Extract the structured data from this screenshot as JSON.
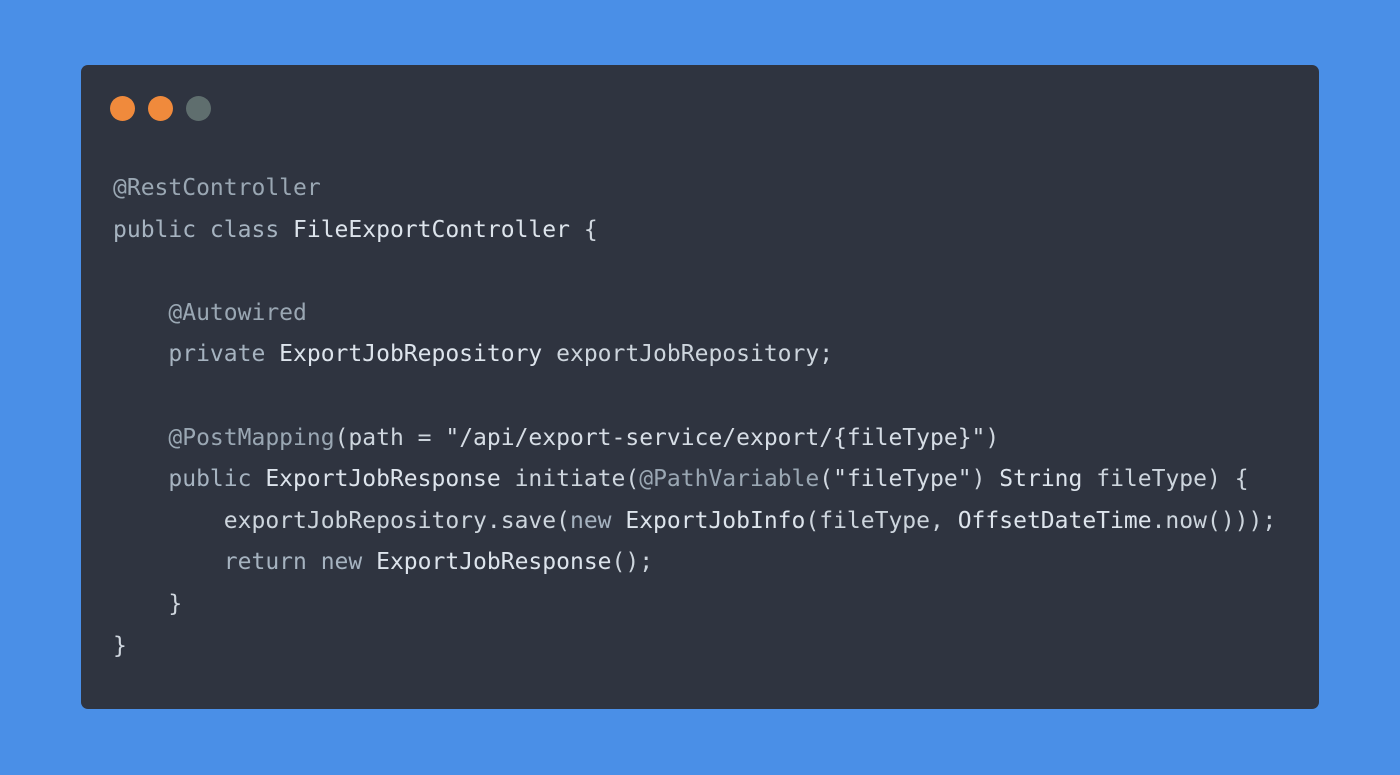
{
  "colors": {
    "background": "#4a8fe7",
    "window": "#2f3440",
    "dot_1": "#f08a3c",
    "dot_2": "#f08a3c",
    "dot_3": "#5f6e6e"
  },
  "code": {
    "language": "java",
    "lines": [
      [
        {
          "t": "@RestController",
          "k": "ann"
        }
      ],
      [
        {
          "t": "public class ",
          "k": "kw"
        },
        {
          "t": "FileExportController",
          "k": "type"
        },
        {
          "t": " {",
          "k": "punct"
        }
      ],
      [],
      [
        {
          "t": "    ",
          "k": "ident"
        },
        {
          "t": "@Autowired",
          "k": "ann"
        }
      ],
      [
        {
          "t": "    ",
          "k": "ident"
        },
        {
          "t": "private ",
          "k": "kw"
        },
        {
          "t": "ExportJobRepository",
          "k": "type"
        },
        {
          "t": " exportJobRepository;",
          "k": "ident"
        }
      ],
      [],
      [
        {
          "t": "    ",
          "k": "ident"
        },
        {
          "t": "@PostMapping",
          "k": "ann"
        },
        {
          "t": "(path = ",
          "k": "ident"
        },
        {
          "t": "\"/api/export-service/export/{fileType}\"",
          "k": "str"
        },
        {
          "t": ")",
          "k": "punct"
        }
      ],
      [
        {
          "t": "    ",
          "k": "ident"
        },
        {
          "t": "public ",
          "k": "kw"
        },
        {
          "t": "ExportJobResponse",
          "k": "type"
        },
        {
          "t": " initiate(",
          "k": "ident"
        },
        {
          "t": "@PathVariable",
          "k": "ann"
        },
        {
          "t": "(",
          "k": "punct"
        },
        {
          "t": "\"fileType\"",
          "k": "str"
        },
        {
          "t": ") ",
          "k": "punct"
        },
        {
          "t": "String",
          "k": "type"
        },
        {
          "t": " fileType) {",
          "k": "ident"
        }
      ],
      [
        {
          "t": "        exportJobRepository.save(",
          "k": "ident"
        },
        {
          "t": "new ",
          "k": "kw"
        },
        {
          "t": "ExportJobInfo",
          "k": "type"
        },
        {
          "t": "(fileType, ",
          "k": "ident"
        },
        {
          "t": "OffsetDateTime",
          "k": "type"
        },
        {
          "t": ".now()));",
          "k": "ident"
        }
      ],
      [
        {
          "t": "        ",
          "k": "ident"
        },
        {
          "t": "return new ",
          "k": "kw"
        },
        {
          "t": "ExportJobResponse",
          "k": "type"
        },
        {
          "t": "();",
          "k": "ident"
        }
      ],
      [
        {
          "t": "    }",
          "k": "punct"
        }
      ],
      [
        {
          "t": "}",
          "k": "punct"
        }
      ]
    ]
  }
}
